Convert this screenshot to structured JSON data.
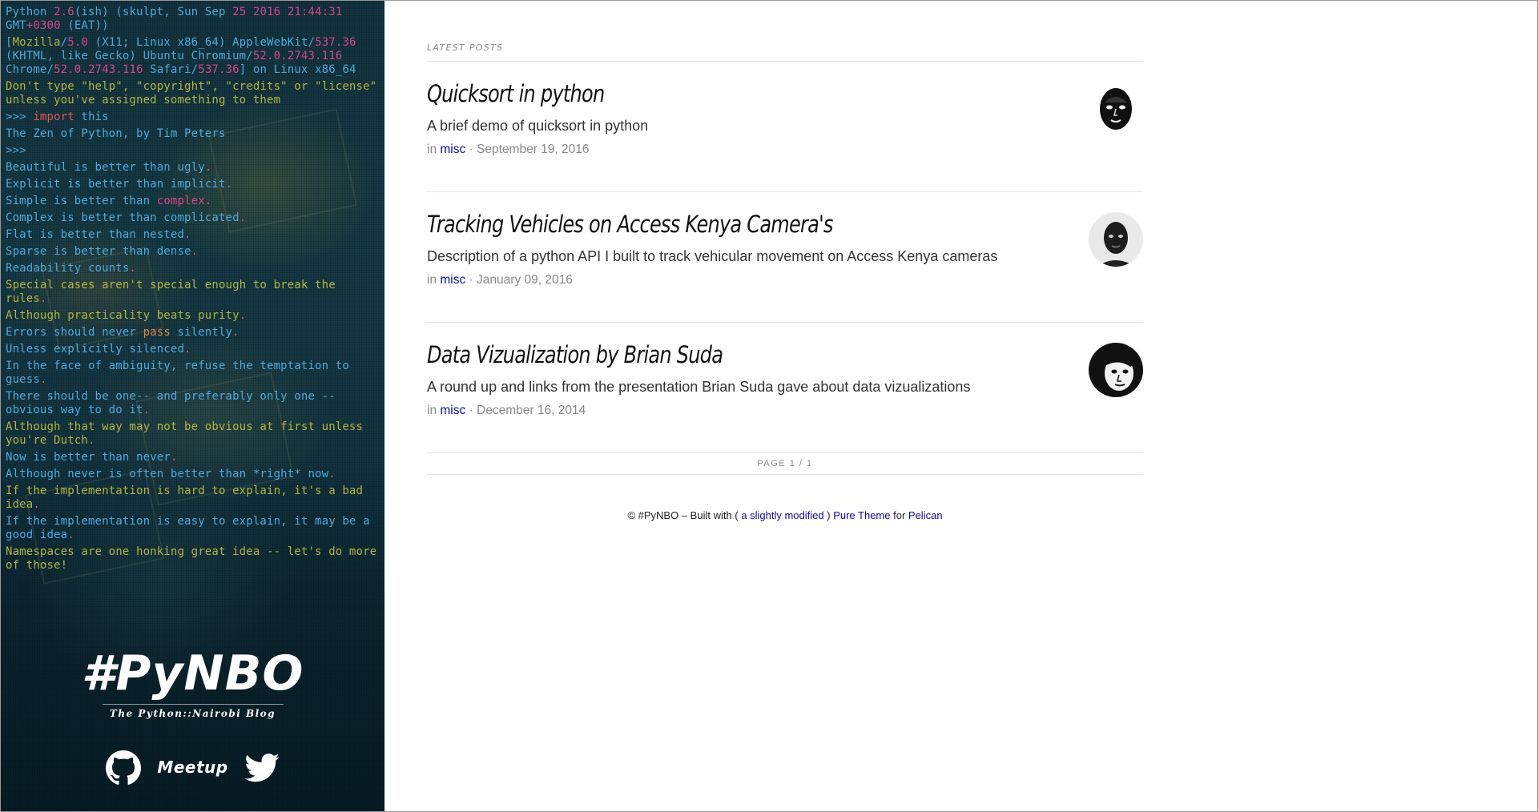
{
  "sidebar": {
    "console_lines": [
      [
        [
          "Python ",
          "b"
        ],
        [
          "2.6",
          "p"
        ],
        [
          "(ish) (skulpt, Sun Sep ",
          "b"
        ],
        [
          "25",
          "p"
        ],
        [
          " ",
          "b"
        ],
        [
          "2016",
          "p"
        ],
        [
          " ",
          "b"
        ],
        [
          "21:44:31",
          "p"
        ],
        [
          " GMT",
          "b"
        ],
        [
          "+0300",
          "p"
        ],
        [
          " (EAT))",
          "b"
        ]
      ],
      [
        [
          "[",
          "b"
        ],
        [
          "Mozilla",
          "y"
        ],
        [
          "/",
          "b"
        ],
        [
          "5.0",
          "p"
        ],
        [
          " (X11; Linux x86_64) AppleWebKit/",
          "b"
        ],
        [
          "537.36",
          "p"
        ],
        [
          " (KHTML, like Gecko) Ubuntu Chromium/",
          "b"
        ],
        [
          "52.0.2743.116",
          "p"
        ],
        [
          " Chrome/",
          "b"
        ],
        [
          "52.0.2743.116",
          "p"
        ],
        [
          " Safari/",
          "b"
        ],
        [
          "537.36",
          "p"
        ],
        [
          "] on Linux x86_64",
          "b"
        ]
      ],
      [
        [
          "Don't type \"help\", \"copyright\", \"credits\" or \"license\" unless you've assigned something to them",
          "y"
        ]
      ],
      [
        [
          ">>> ",
          "b"
        ],
        [
          "import",
          "r"
        ],
        [
          " this",
          "b"
        ]
      ],
      [
        [
          "The Zen of Python, by Tim Peters",
          "b"
        ]
      ],
      [
        [
          ">>>",
          "b"
        ]
      ],
      [
        [
          "Beautiful is better than ugly",
          "b"
        ],
        [
          ".",
          "r"
        ]
      ],
      [
        [
          "Explicit is better than implicit",
          "b"
        ],
        [
          ".",
          "r"
        ]
      ],
      [
        [
          "Simple is better than ",
          "b"
        ],
        [
          "complex",
          "p"
        ],
        [
          ".",
          "r"
        ]
      ],
      [
        [
          "Complex is better than complicated",
          "b"
        ],
        [
          ".",
          "r"
        ]
      ],
      [
        [
          "Flat is better than nested",
          "b"
        ],
        [
          ".",
          "r"
        ]
      ],
      [
        [
          "Sparse is better than dense",
          "b"
        ],
        [
          ".",
          "r"
        ]
      ],
      [
        [
          "Readability counts",
          "b"
        ],
        [
          ".",
          "r"
        ]
      ],
      [
        [
          "Special cases aren't special enough to break the rules",
          "y"
        ],
        [
          ".",
          "r"
        ]
      ],
      [
        [
          "Although practicality beats purity",
          "y"
        ],
        [
          ".",
          "r"
        ]
      ],
      [
        [
          "Errors should never ",
          "b"
        ],
        [
          "pass",
          "o"
        ],
        [
          " silently",
          "b"
        ],
        [
          ".",
          "r"
        ]
      ],
      [
        [
          "Unless explicitly silenced",
          "b"
        ],
        [
          ".",
          "r"
        ]
      ],
      [
        [
          "In the face of ambiguity, refuse the temptation to guess",
          "b"
        ],
        [
          ".",
          "r"
        ]
      ],
      [
        [
          "There should be one-- and preferably only one --obvious way to do it",
          "b"
        ],
        [
          ".",
          "r"
        ]
      ],
      [
        [
          "Although that way may not be obvious at first unless you're Dutch",
          "y"
        ],
        [
          ".",
          "r"
        ]
      ],
      [
        [
          "Now is better than never",
          "b"
        ],
        [
          ".",
          "r"
        ]
      ],
      [
        [
          "Although never is often better than *right* now",
          "b"
        ],
        [
          ".",
          "r"
        ]
      ],
      [
        [
          "If the implementation is hard to explain, it's a bad idea",
          "y"
        ],
        [
          ".",
          "r"
        ]
      ],
      [
        [
          "If the implementation is easy to explain, it may be a good idea",
          "b"
        ],
        [
          ".",
          "r"
        ]
      ],
      [
        [
          "Namespaces are one honking great idea -- let's do more of those!",
          "y"
        ]
      ]
    ],
    "brand_title": "#PyNBO",
    "brand_subtitle": "The Python::Nairobi Blog",
    "social": {
      "github": "github-icon",
      "meetup_label": "Meetup",
      "twitter": "twitter-icon"
    }
  },
  "main": {
    "section_label": "LATEST POSTS",
    "posts": [
      {
        "title": "Quicksort in python",
        "description": "A brief demo of quicksort in python",
        "in": "in",
        "category": "misc",
        "sep": "·",
        "date": "September 19, 2016"
      },
      {
        "title": "Tracking Vehicles on Access Kenya Camera's",
        "description": "Description of a python API I built to track vehicular movement on Access Kenya cameras",
        "in": "in",
        "category": "misc",
        "sep": "·",
        "date": "January 09, 2016"
      },
      {
        "title": "Data Vizualization by Brian Suda",
        "description": "A round up and links from the presentation Brian Suda gave about data vizualizations",
        "in": "in",
        "category": "misc",
        "sep": "·",
        "date": "December 16, 2014"
      }
    ],
    "pager": "PAGE 1 / 1",
    "footer": {
      "prefix": "© #PyNBO – Built with (",
      "modified": "a slightly modified",
      "mid": ")",
      "theme": "Pure Theme",
      "for": "for",
      "pelican": "Pelican"
    }
  },
  "colors": {
    "link": "#0b0bb3",
    "sidebar_bg": "#13333f",
    "console_blue": "#4ea9de",
    "console_yellow": "#b2b53a",
    "console_pink": "#d6458a"
  }
}
